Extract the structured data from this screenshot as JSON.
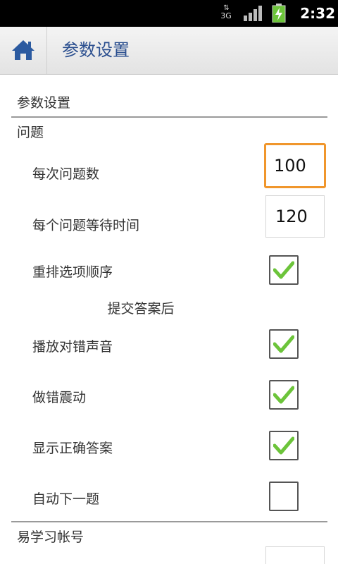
{
  "status_bar": {
    "network": "3G",
    "time": "2:32"
  },
  "title_bar": {
    "title": "参数设置",
    "home_icon": "home-icon"
  },
  "screen": {
    "header": "参数设置",
    "sections": [
      {
        "title": "问题",
        "items": [
          {
            "label": "每次问题数",
            "type": "number",
            "value": "100",
            "focused": true
          },
          {
            "label": "每个问题等待时间",
            "type": "number",
            "value": "120"
          },
          {
            "label": "重排选项顺序",
            "type": "checkbox",
            "checked": true
          }
        ]
      },
      {
        "subheader": "提交答案后",
        "items": [
          {
            "label": "播放对错声音",
            "type": "checkbox",
            "checked": true
          },
          {
            "label": "做错震动",
            "type": "checkbox",
            "checked": true
          },
          {
            "label": "显示正确答案",
            "type": "checkbox",
            "checked": true
          },
          {
            "label": "自动下一题",
            "type": "checkbox",
            "checked": false
          }
        ]
      },
      {
        "title": "易学习帐号",
        "items": []
      }
    ]
  },
  "colors": {
    "title_text": "#2b4f8f",
    "focus_border": "#f0962c",
    "check_green": "#6cc43a"
  }
}
